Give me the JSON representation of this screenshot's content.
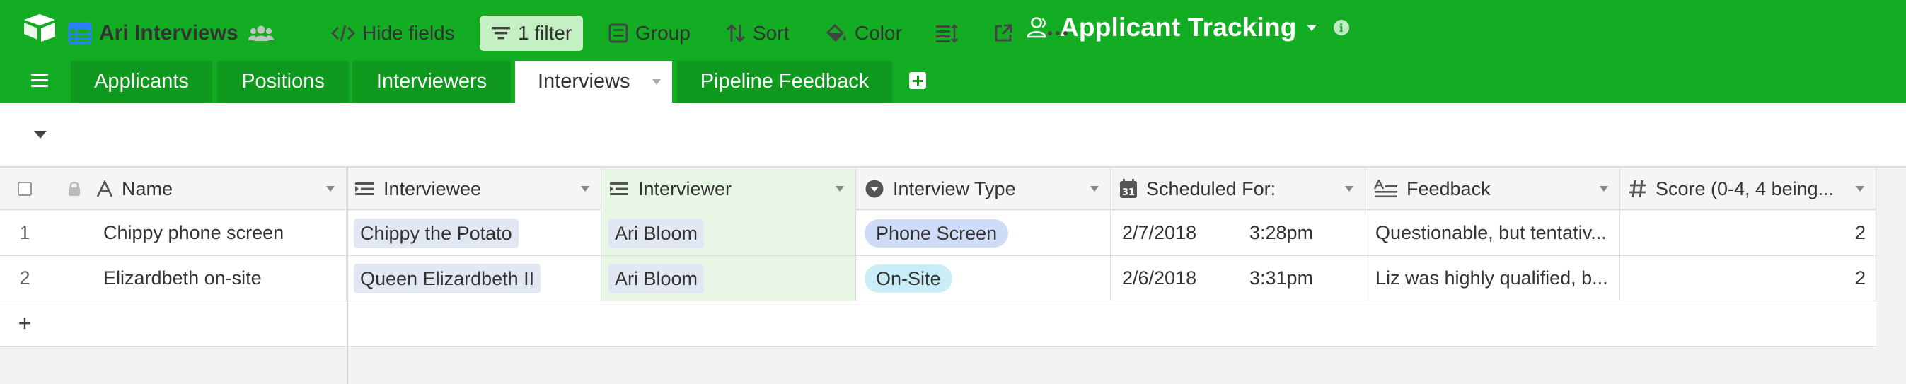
{
  "header": {
    "base_name": "Applicant Tracking"
  },
  "tabs": [
    {
      "label": "Applicants"
    },
    {
      "label": "Positions"
    },
    {
      "label": "Interviewers"
    },
    {
      "label": "Interviews"
    },
    {
      "label": "Pipeline Feedback"
    }
  ],
  "toolbar": {
    "view_name": "Ari Interviews",
    "hide_fields": "Hide fields",
    "filter": "1 filter",
    "group": "Group",
    "sort": "Sort",
    "color": "Color"
  },
  "columns": [
    {
      "label": "Name",
      "icon": "text-field-icon"
    },
    {
      "label": "Interviewee",
      "icon": "link-field-icon"
    },
    {
      "label": "Interviewer",
      "icon": "link-field-icon"
    },
    {
      "label": "Interview Type",
      "icon": "single-select-icon"
    },
    {
      "label": "Scheduled For:",
      "icon": "calendar-icon"
    },
    {
      "label": "Feedback",
      "icon": "long-text-icon"
    },
    {
      "label": "Score (0-4, 4 being...",
      "icon": "number-icon"
    }
  ],
  "rows": [
    {
      "num": "1",
      "name": "Chippy phone screen",
      "interviewee": "Chippy the Potato",
      "interviewer": "Ari Bloom",
      "type": "Phone Screen",
      "type_color": "#cfdcf8",
      "date": "2/7/2018",
      "time": "3:28pm",
      "feedback": "Questionable, but tentativ...",
      "score": "2"
    },
    {
      "num": "2",
      "name": "Elizardbeth on-site",
      "interviewee": "Queen Elizardbeth II",
      "interviewer": "Ari Bloom",
      "type": "On-Site",
      "type_color": "#c9eef8",
      "date": "2/6/2018",
      "time": "3:31pm",
      "feedback": "Liz was highly qualified, b...",
      "score": "2"
    }
  ],
  "add_row_label": "+",
  "colors": {
    "brand": "#13ad24",
    "filter_bg": "#c5f0c3"
  }
}
